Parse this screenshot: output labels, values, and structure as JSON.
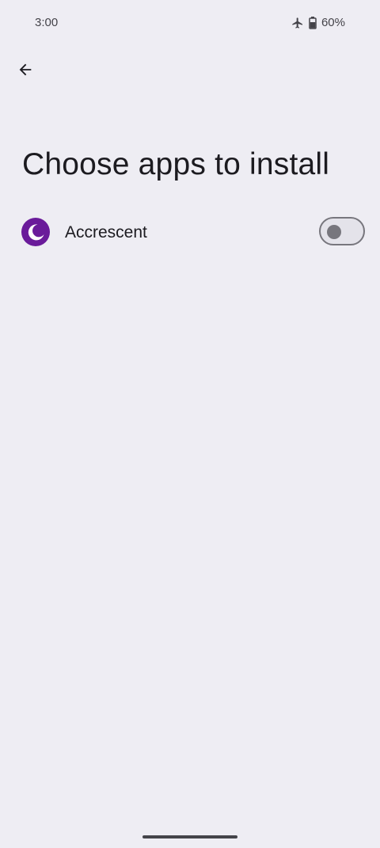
{
  "status_bar": {
    "time": "3:00",
    "battery": "60%",
    "icons": [
      "airplane-icon",
      "battery-icon"
    ]
  },
  "header": {
    "back_icon": "arrow-back-icon",
    "title": "Choose apps to install"
  },
  "apps": [
    {
      "name": "Accrescent",
      "icon": "accrescent-logo",
      "selected": false
    }
  ],
  "colors": {
    "background": "#eeedf3",
    "accent": "#6a1b9a",
    "toggle_outline": "#77767d"
  }
}
